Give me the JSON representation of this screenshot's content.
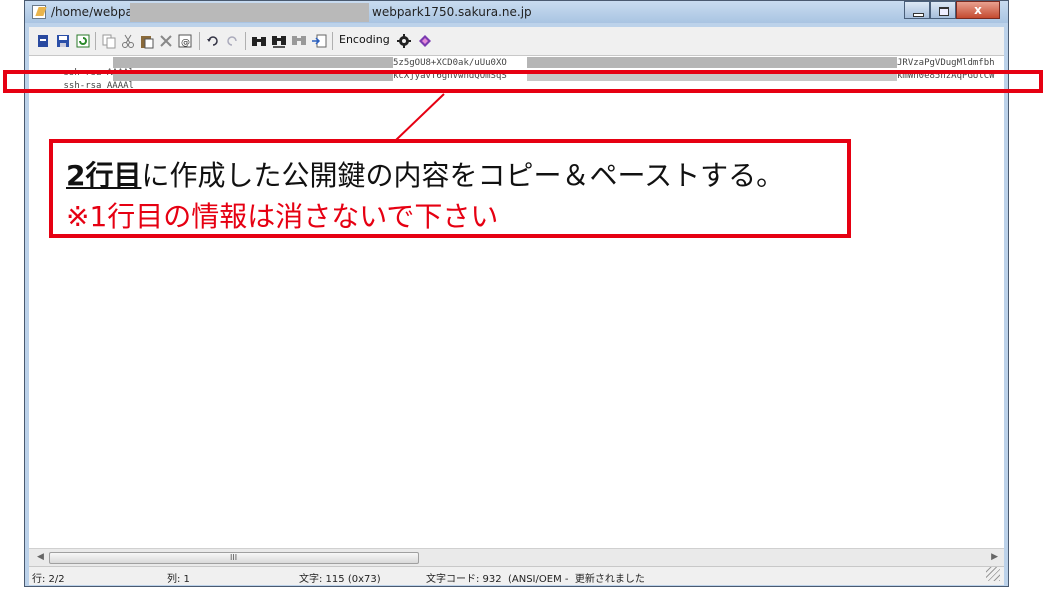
{
  "window": {
    "title_path": "/home/webpar",
    "title_host": "webpark1750.sakura.ne.jp",
    "close_glyph": "x"
  },
  "toolbar": {
    "encoding_label": "Encoding",
    "icons": [
      "find-prev-icon",
      "save-icon",
      "refresh-icon",
      "copy-icon",
      "cut-icon",
      "paste-icon",
      "delete-icon",
      "select-all-icon",
      "undo-icon",
      "redo-icon",
      "find-icon",
      "find-next-icon",
      "find-all-icon",
      "jump-icon",
      "settings-icon",
      "info-icon"
    ]
  },
  "editor": {
    "line1_start": "ssh-rsa AAAAl",
    "line1_mid": "5z5gOU8+XCD0ak/uUu0XO",
    "line1_end": "JRVzaPgVDugMldmfbh",
    "line2_start": "ssh-rsa AAAAl",
    "line2_mid": "kcXjyavT6ghVwndQOmSqS",
    "line2_end": "kmWh0e85nzAqPGUlCW"
  },
  "scrollbar": {
    "grip": "III"
  },
  "status": {
    "line": "行: 2/2",
    "column": "列: 1",
    "chars": "文字: 115 (0x73)",
    "charcode": "文字コード: 932  (ANSI/OEM -  更新されました"
  },
  "annotation": {
    "line1_underlined": "2行目",
    "line1_rest": "に作成した公開鍵の内容をコピー＆ペーストする。",
    "line2": "※1行目の情報は消さないで下さい"
  },
  "colors": {
    "highlight": "#e60012"
  }
}
